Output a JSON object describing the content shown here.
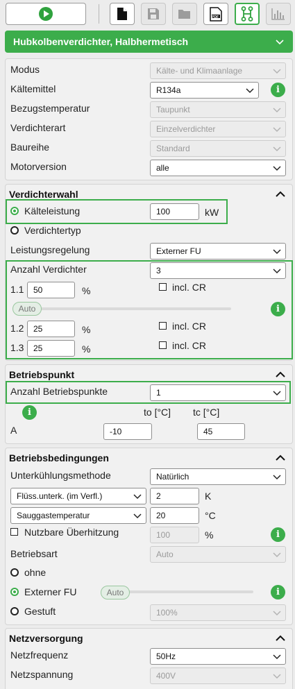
{
  "toolbar": {
    "play": "play-icon",
    "new": "new-document-icon",
    "save": "save-icon",
    "open": "folder-icon",
    "pdf_label": "PDF",
    "diagram": "diagram-icon",
    "chart": "bar-chart-icon"
  },
  "banner": {
    "title": "Hubkolbenverdichter, Halbhermetisch"
  },
  "general": {
    "modus_label": "Modus",
    "modus_value": "Kälte- und Klimaanlage",
    "refrigerant_label": "Kältemittel",
    "refrigerant_value": "R134a",
    "ref_temp_label": "Bezugstemperatur",
    "ref_temp_value": "Taupunkt",
    "comp_type_label": "Verdichterart",
    "comp_type_value": "Einzelverdichter",
    "series_label": "Baureihe",
    "series_value": "Standard",
    "motor_label": "Motorversion",
    "motor_value": "alle"
  },
  "selection": {
    "title": "Verdichterwahl",
    "capacity_label": "Kälteleistung",
    "capacity_value": "100",
    "capacity_unit": "kW",
    "comp_type_label": "Verdichtertyp",
    "control_label": "Leistungsregelung",
    "control_value": "Externer FU",
    "count_label": "Anzahl Verdichter",
    "count_value": "3",
    "row1_label": "1.1",
    "row1_value": "50",
    "row2_label": "1.2",
    "row2_value": "25",
    "row3_label": "1.3",
    "row3_value": "25",
    "percent": "%",
    "incl_cr": "incl. CR",
    "auto": "Auto"
  },
  "operating_point": {
    "title": "Betriebspunkt",
    "count_label": "Anzahl Betriebspunkte",
    "count_value": "1",
    "to_header": "to [°C]",
    "tc_header": "tc [°C]",
    "row_label": "A",
    "to_value": "-10",
    "tc_value": "45"
  },
  "conditions": {
    "title": "Betriebsbedingungen",
    "subcool_label": "Unterkühlungsmethode",
    "subcool_value": "Natürlich",
    "liquid_select": "Flüss.unterk. (im Verfl.)",
    "liquid_value": "2",
    "liquid_unit": "K",
    "suction_select": "Sauggastemperatur",
    "suction_value": "20",
    "suction_unit": "°C",
    "superheat_label": "Nutzbare Überhitzung",
    "superheat_value": "100",
    "superheat_unit": "%",
    "mode_label": "Betriebsart",
    "mode_value": "Auto",
    "opt_none": "ohne",
    "opt_fu": "Externer FU",
    "opt_fu_pill": "Auto",
    "opt_staged": "Gestuft",
    "staged_value": "100%"
  },
  "power": {
    "title": "Netzversorgung",
    "freq_label": "Netzfrequenz",
    "freq_value": "50Hz",
    "voltage_label": "Netzspannung",
    "voltage_value": "400V"
  },
  "colors": {
    "accent": "#3cad4b"
  }
}
